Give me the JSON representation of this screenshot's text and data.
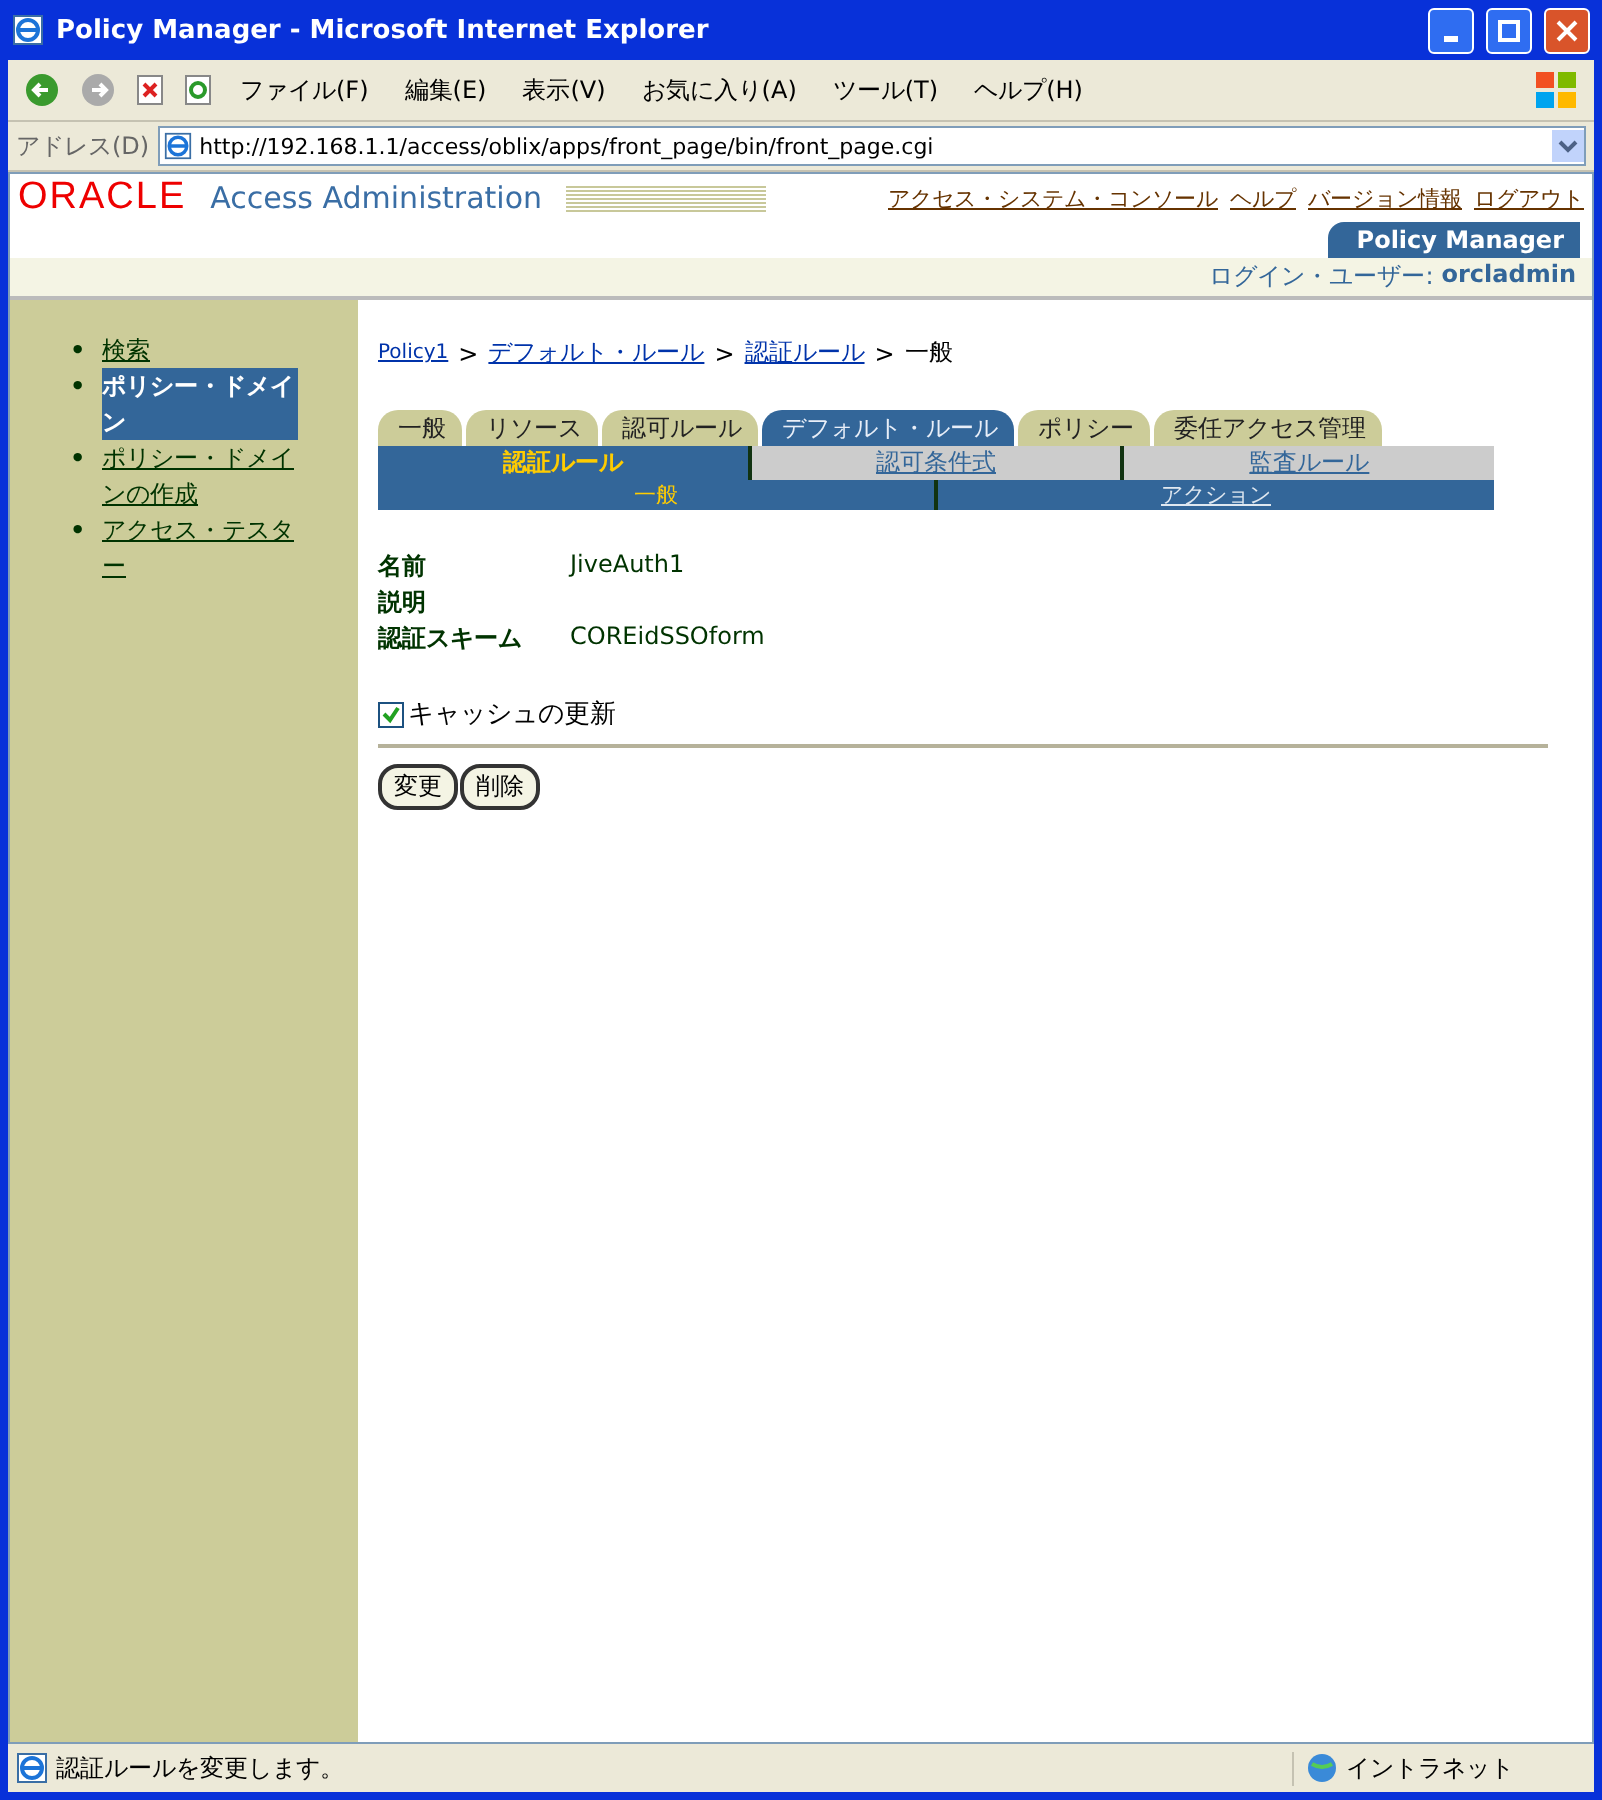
{
  "window": {
    "title": "Policy Manager - Microsoft Internet Explorer"
  },
  "menu": [
    "ファイル(F)",
    "編集(E)",
    "表示(V)",
    "お気に入り(A)",
    "ツール(T)",
    "ヘルプ(H)"
  ],
  "address": {
    "label": "アドレス(D)",
    "url": "http://192.168.1.1/access/oblix/apps/front_page/bin/front_page.cgi"
  },
  "header": {
    "logo": "ORACLE",
    "app_title": "Access Administration",
    "links": [
      "アクセス・システム・コンソール",
      "ヘルプ",
      "バージョン情報",
      "ログアウト"
    ],
    "app_tab": "Policy Manager",
    "login_label": "ログイン・ユーザー:",
    "user": "orcladmin"
  },
  "sidebar": {
    "bullet": "•",
    "items": [
      {
        "label": "検索",
        "selected": false
      },
      {
        "label": "ポリシー・ドメイン",
        "selected": true
      },
      {
        "label": "ポリシー・ドメインの作成",
        "selected": false
      },
      {
        "label": "アクセス・テスター",
        "selected": false
      }
    ]
  },
  "breadcrumb": [
    {
      "label": "Policy1",
      "current": false
    },
    {
      "label": "デフォルト・ルール",
      "current": false
    },
    {
      "label": "認証ルール",
      "current": false
    },
    {
      "label": "一般",
      "current": true
    }
  ],
  "breadcrumb_separator": ">",
  "tabs": [
    {
      "label": "一般",
      "selected": false
    },
    {
      "label": "リソース",
      "selected": false
    },
    {
      "label": "認可ルール",
      "selected": false
    },
    {
      "label": "デフォルト・ルール",
      "selected": true
    },
    {
      "label": "ポリシー",
      "selected": false
    },
    {
      "label": "委任アクセス管理",
      "selected": false
    }
  ],
  "subtabs": [
    {
      "label": "認証ルール",
      "selected": true
    },
    {
      "label": "認可条件式",
      "selected": false
    },
    {
      "label": "監査ルール",
      "selected": false
    }
  ],
  "subsubtabs": [
    {
      "label": "一般",
      "selected": true
    },
    {
      "label": "アクション",
      "selected": false
    }
  ],
  "fields": [
    {
      "label": "名前",
      "value": "JiveAuth1"
    },
    {
      "label": "説明"
    },
    {
      "label": "認証スキーム",
      "value": "COREidSSOform"
    }
  ],
  "cache_update": {
    "label": "キャッシュの更新",
    "checked": true
  },
  "buttons": [
    "変更",
    "削除"
  ],
  "status_bar": {
    "text": "認証ルールを変更します。",
    "zone": "イントラネット"
  }
}
